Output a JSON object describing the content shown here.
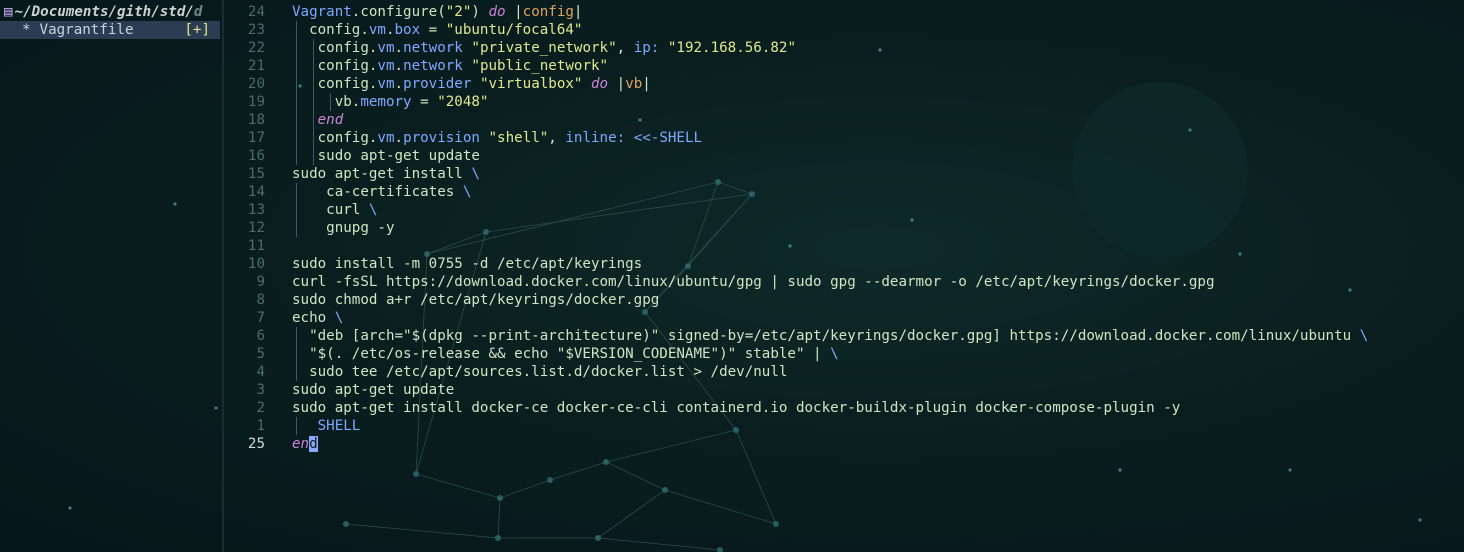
{
  "sidebar": {
    "icon": "▤",
    "path_main": "~/Documents/gith/std/",
    "path_tail": "d",
    "file_marker": "*",
    "file_name": "Vagrantfile",
    "modified_flag": "[+]"
  },
  "editor": {
    "lines": [
      {
        "n": "24",
        "indent": 0,
        "guides": [],
        "tokens": [
          [
            "Vagrant",
            "p"
          ],
          [
            ".configure(",
            "n"
          ],
          [
            "\"2\"",
            "s"
          ],
          [
            ") ",
            "n"
          ],
          [
            "do",
            "k"
          ],
          [
            " |",
            "n"
          ],
          [
            "config",
            "o"
          ],
          [
            "|",
            "n"
          ]
        ]
      },
      {
        "n": "23",
        "indent": 0,
        "guides": [
          0
        ],
        "tokens": [
          [
            "  config.",
            "n"
          ],
          [
            "vm",
            "p"
          ],
          [
            ".",
            "n"
          ],
          [
            "box",
            "p"
          ],
          [
            " = ",
            "n"
          ],
          [
            "\"ubuntu/focal64\"",
            "s"
          ]
        ]
      },
      {
        "n": "22",
        "indent": 0,
        "guides": [
          0,
          2
        ],
        "tokens": [
          [
            "   config.",
            "n"
          ],
          [
            "vm",
            "p"
          ],
          [
            ".",
            "n"
          ],
          [
            "network",
            "p"
          ],
          [
            " ",
            "n"
          ],
          [
            "\"private_network\"",
            "s"
          ],
          [
            ", ",
            "n"
          ],
          [
            "ip:",
            "p"
          ],
          [
            " ",
            "n"
          ],
          [
            "\"192.168.56.82\"",
            "s"
          ]
        ]
      },
      {
        "n": "21",
        "indent": 0,
        "guides": [
          0,
          2
        ],
        "tokens": [
          [
            "   config.",
            "n"
          ],
          [
            "vm",
            "p"
          ],
          [
            ".",
            "n"
          ],
          [
            "network",
            "p"
          ],
          [
            " ",
            "n"
          ],
          [
            "\"public_network\"",
            "s"
          ]
        ]
      },
      {
        "n": "20",
        "indent": 0,
        "guides": [
          0,
          2
        ],
        "tokens": [
          [
            "   config.",
            "n"
          ],
          [
            "vm",
            "p"
          ],
          [
            ".",
            "n"
          ],
          [
            "provider",
            "p"
          ],
          [
            " ",
            "n"
          ],
          [
            "\"virtualbox\"",
            "s"
          ],
          [
            " ",
            "n"
          ],
          [
            "do",
            "k"
          ],
          [
            " |",
            "n"
          ],
          [
            "vb",
            "o"
          ],
          [
            "|",
            "n"
          ]
        ]
      },
      {
        "n": "19",
        "indent": 0,
        "guides": [
          0,
          2,
          4
        ],
        "tokens": [
          [
            "     vb.",
            "n"
          ],
          [
            "memory",
            "p"
          ],
          [
            " = ",
            "n"
          ],
          [
            "\"2048\"",
            "s"
          ]
        ]
      },
      {
        "n": "18",
        "indent": 0,
        "guides": [
          0,
          2
        ],
        "tokens": [
          [
            "   ",
            "n"
          ],
          [
            "end",
            "k"
          ]
        ]
      },
      {
        "n": "17",
        "indent": 0,
        "guides": [
          0,
          2
        ],
        "tokens": [
          [
            "   config.",
            "n"
          ],
          [
            "vm",
            "p"
          ],
          [
            ".",
            "n"
          ],
          [
            "provision",
            "p"
          ],
          [
            " ",
            "n"
          ],
          [
            "\"shell\"",
            "s"
          ],
          [
            ", ",
            "n"
          ],
          [
            "inline:",
            "p"
          ],
          [
            " ",
            "n"
          ],
          [
            "<<-SHELL",
            "p"
          ]
        ]
      },
      {
        "n": "16",
        "indent": 0,
        "guides": [
          0,
          2
        ],
        "tokens": [
          [
            "   sudo apt-get update",
            "sh"
          ]
        ]
      },
      {
        "n": "15",
        "indent": 0,
        "guides": [],
        "tokens": [
          [
            "sudo apt-get install ",
            "sh"
          ],
          [
            "\\",
            "p"
          ]
        ]
      },
      {
        "n": "14",
        "indent": 0,
        "guides": [
          0
        ],
        "tokens": [
          [
            "    ca-certificates ",
            "sh"
          ],
          [
            "\\",
            "p"
          ]
        ]
      },
      {
        "n": "13",
        "indent": 0,
        "guides": [
          0
        ],
        "tokens": [
          [
            "    curl ",
            "sh"
          ],
          [
            "\\",
            "p"
          ]
        ]
      },
      {
        "n": "12",
        "indent": 0,
        "guides": [
          0
        ],
        "tokens": [
          [
            "    gnupg -y",
            "sh"
          ]
        ]
      },
      {
        "n": "11",
        "indent": 0,
        "guides": [],
        "tokens": []
      },
      {
        "n": "10",
        "indent": 0,
        "guides": [],
        "tokens": [
          [
            "sudo install -m 0755 -d /etc/apt/keyrings",
            "sh"
          ]
        ]
      },
      {
        "n": "9",
        "indent": 0,
        "guides": [],
        "tokens": [
          [
            "curl -fsSL https://download.docker.com/linux/ubuntu/gpg | sudo gpg --dearmor -o /etc/apt/keyrings/docker.gpg",
            "sh"
          ]
        ]
      },
      {
        "n": "8",
        "indent": 0,
        "guides": [],
        "tokens": [
          [
            "sudo chmod a+r /etc/apt/keyrings/docker.gpg",
            "sh"
          ]
        ]
      },
      {
        "n": "7",
        "indent": 0,
        "guides": [],
        "tokens": [
          [
            "echo ",
            "sh"
          ],
          [
            "\\",
            "p"
          ]
        ]
      },
      {
        "n": "6",
        "indent": 0,
        "guides": [
          0
        ],
        "tokens": [
          [
            "  \"deb [arch=\"$(dpkg --print-architecture)\" signed-by=/etc/apt/keyrings/docker.gpg] https://download.docker.com/linux/ubuntu ",
            "sh"
          ],
          [
            "\\",
            "p"
          ]
        ]
      },
      {
        "n": "5",
        "indent": 0,
        "guides": [
          0
        ],
        "tokens": [
          [
            "  \"$(. /etc/os-release && echo \"$VERSION_CODENAME\")\" stable\" | ",
            "sh"
          ],
          [
            "\\",
            "p"
          ]
        ]
      },
      {
        "n": "4",
        "indent": 0,
        "guides": [
          0
        ],
        "tokens": [
          [
            "  sudo tee /etc/apt/sources.list.d/docker.list > /dev/null",
            "sh"
          ]
        ]
      },
      {
        "n": "3",
        "indent": 0,
        "guides": [],
        "tokens": [
          [
            "sudo apt-get update",
            "sh"
          ]
        ]
      },
      {
        "n": "2",
        "indent": 0,
        "guides": [],
        "tokens": [
          [
            "sudo apt-get install docker-ce docker-ce-cli containerd.io docker-buildx-plugin docker-compose-plugin -y",
            "sh"
          ]
        ]
      },
      {
        "n": "1",
        "indent": 0,
        "guides": [
          0
        ],
        "tokens": [
          [
            "   SHELL",
            "p"
          ]
        ]
      },
      {
        "n": "25",
        "indent": 0,
        "guides": [],
        "current": true,
        "tokens": [
          [
            "en",
            "k"
          ],
          [
            "d",
            "cursor"
          ]
        ]
      }
    ]
  },
  "colors": {
    "background": "#0a1e1f",
    "keyword": "#cb83d6",
    "string": "#dfe891",
    "property": "#7fa8ff",
    "block_param": "#e0a35f",
    "selection_bg": "#2a3d52",
    "modified_flag": "#e9e28a"
  }
}
